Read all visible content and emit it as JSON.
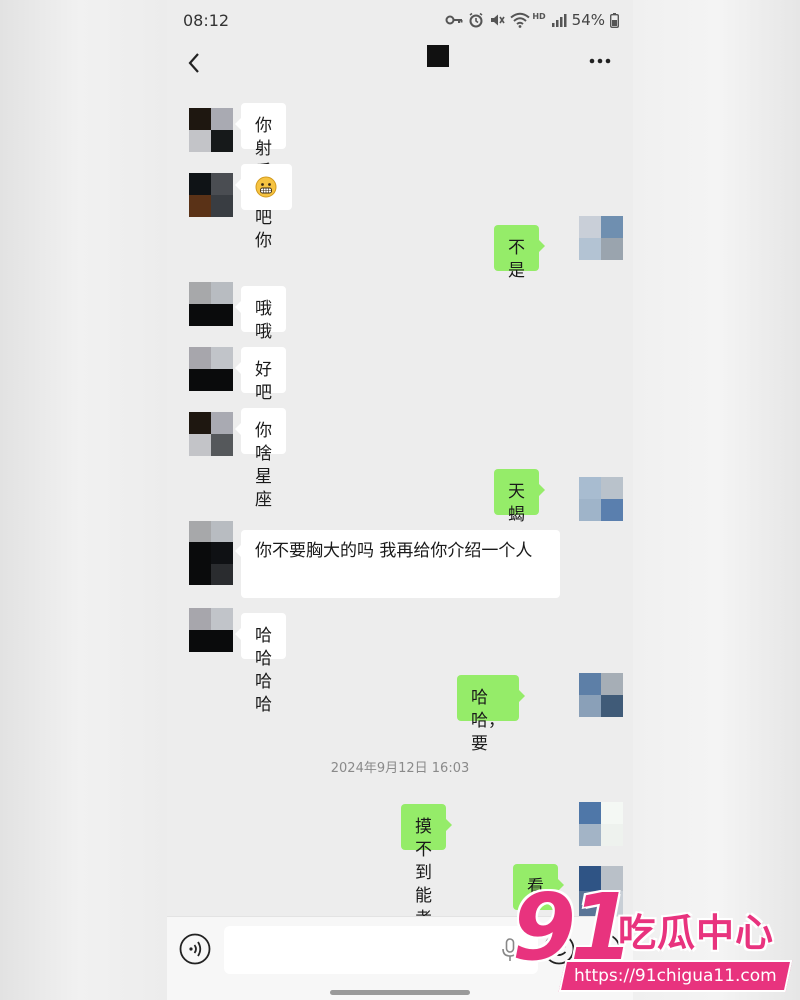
{
  "status_bar": {
    "time": "08:12",
    "hd_label": "HD",
    "battery": "54%",
    "icons": [
      "key-icon",
      "alarm-icon",
      "mute-icon",
      "wifi-icon",
      "signal-icon",
      "battery-icon"
    ]
  },
  "nav": {
    "back_icon": "chevron-left-icon",
    "more_icon": "more-dots-icon"
  },
  "messages": [
    {
      "side": "in",
      "text": "你射手座吧你"
    },
    {
      "side": "in",
      "emoji": "grimace-emoji"
    },
    {
      "side": "out",
      "text": "不是"
    },
    {
      "side": "in",
      "text": "哦哦"
    },
    {
      "side": "in",
      "text": "好吧"
    },
    {
      "side": "in",
      "text": "你啥星座"
    },
    {
      "side": "out",
      "text": "天蝎"
    },
    {
      "side": "in",
      "text": "你不要胸大的吗 我再给你介绍一个人"
    },
    {
      "side": "in",
      "text": "哈哈哈哈"
    },
    {
      "side": "out",
      "text": "哈哈，要"
    },
    {
      "side": "out",
      "text": "摸不到能考也行"
    },
    {
      "side": "out",
      "text": "看"
    }
  ],
  "timestamp": "2024年9月12日 16:03",
  "input_bar": {
    "text_value": "",
    "icons": [
      "voice-icon",
      "mic-icon",
      "emoji-icon",
      "plus-icon"
    ]
  },
  "watermark": {
    "number": "91",
    "name": "吃瓜中心",
    "url": "https://91chigua11.com",
    "color": "#e8337e"
  },
  "colors": {
    "background": "#ededed",
    "bubble_in": "#ffffff",
    "bubble_out": "#95ec69"
  }
}
